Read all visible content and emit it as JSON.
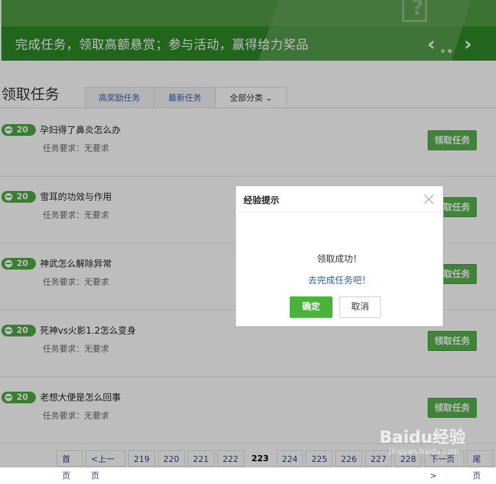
{
  "banner": {
    "text": "完成任务，领取高额悬赏；参与活动，赢得给力奖品",
    "prev": "‹",
    "next": "›"
  },
  "section": {
    "title": "领取任务",
    "tabs": [
      {
        "label": "高奖励任务"
      },
      {
        "label": "最新任务"
      },
      {
        "label": "全部分类 ⌄"
      }
    ]
  },
  "tasks": [
    {
      "reward": "20",
      "title": "孕妇得了鼻炎怎么办",
      "requirement": "任务要求：无要求",
      "button": "领取任务"
    },
    {
      "reward": "20",
      "title": "雪耳的功效与作用",
      "requirement": "任务要求：无要求",
      "button": "领取任务"
    },
    {
      "reward": "20",
      "title": "神武怎么解除异常",
      "requirement": "任务要求：无要求",
      "button": "领取任务"
    },
    {
      "reward": "20",
      "title": "死神vs火影1.2怎么变身",
      "requirement": "任务要求：无要求",
      "button": "领取任务"
    },
    {
      "reward": "20",
      "title": "老想大便是怎么回事",
      "requirement": "任务要求：无要求",
      "button": "领取任务"
    }
  ],
  "pagination": {
    "first": "首页",
    "prev": "<上一页",
    "pages": [
      "219",
      "220",
      "221",
      "222",
      "223",
      "224",
      "225",
      "226",
      "227",
      "228"
    ],
    "current": "223",
    "next": "下一页>",
    "last": "尾页"
  },
  "dialog": {
    "title": "经验提示",
    "message": "领取成功！",
    "link": "去完成任务吧！",
    "ok": "确定",
    "cancel": "取消"
  },
  "watermark": {
    "logo": "Baidu经验",
    "sub": "jingyan.baidu.com"
  },
  "colors": {
    "banner": "#2f8a29",
    "button_green": "#56b24d",
    "link_blue": "#2f5eb6"
  }
}
